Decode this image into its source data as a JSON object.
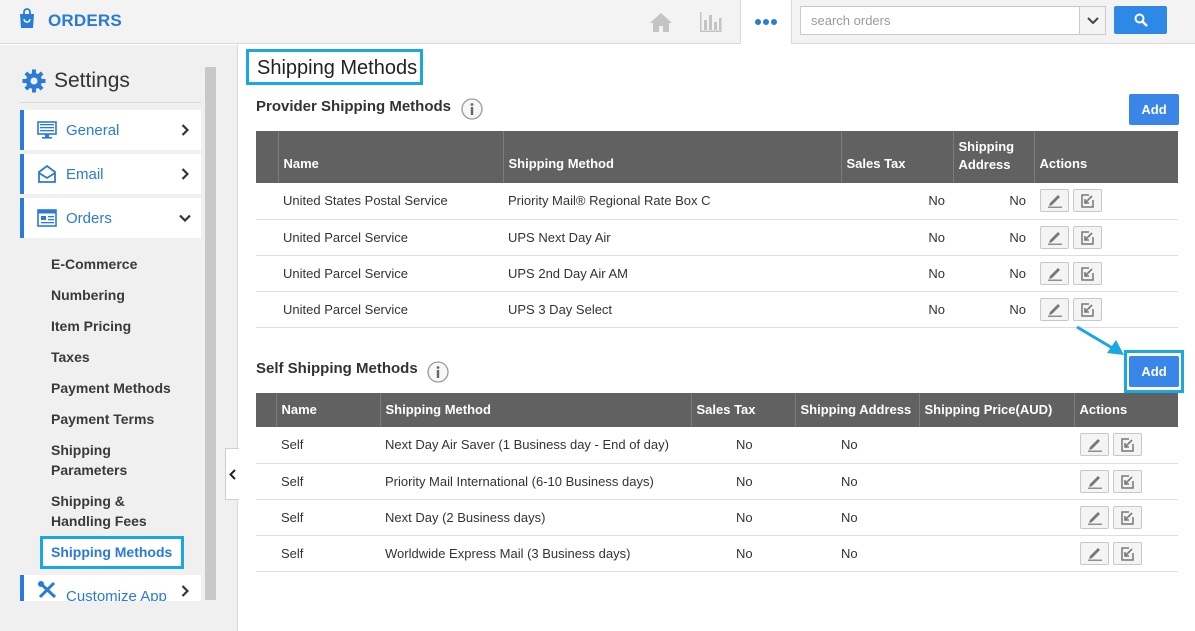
{
  "header": {
    "app_title": "ORDERS",
    "search_placeholder": "search orders"
  },
  "sidebar": {
    "title": "Settings",
    "items": [
      {
        "label": "General"
      },
      {
        "label": "Email"
      },
      {
        "label": "Orders"
      }
    ],
    "sub_items": [
      "E-Commerce",
      "Numbering",
      "Item Pricing",
      "Taxes",
      "Payment Methods",
      "Payment Terms",
      "Shipping Parameters",
      "Shipping & Handling Fees",
      "Shipping Methods"
    ],
    "customize_label": "Customize App"
  },
  "main": {
    "page_title": "Shipping Methods",
    "provider": {
      "title": "Provider Shipping Methods",
      "add_label": "Add",
      "columns": [
        "Name",
        "Shipping Method",
        "Sales Tax",
        "Shipping Address",
        "Actions"
      ],
      "rows": [
        {
          "name": "United States Postal Service",
          "method": "Priority Mail® Regional Rate Box C",
          "sales_tax": "No",
          "shipping_address": "No"
        },
        {
          "name": "United Parcel Service",
          "method": "UPS Next Day Air",
          "sales_tax": "No",
          "shipping_address": "No"
        },
        {
          "name": "United Parcel Service",
          "method": "UPS 2nd Day Air AM",
          "sales_tax": "No",
          "shipping_address": "No"
        },
        {
          "name": "United Parcel Service",
          "method": "UPS 3 Day Select",
          "sales_tax": "No",
          "shipping_address": "No"
        }
      ]
    },
    "self": {
      "title": "Self Shipping Methods",
      "add_label": "Add",
      "columns": [
        "Name",
        "Shipping Method",
        "Sales Tax",
        "Shipping Address",
        "Shipping Price(AUD)",
        "Actions"
      ],
      "rows": [
        {
          "name": "Self",
          "method": "Next Day Air Saver (1 Business day - End of day)",
          "sales_tax": "No",
          "shipping_address": "No",
          "price": ""
        },
        {
          "name": "Self",
          "method": "Priority Mail International (6-10 Business days)",
          "sales_tax": "No",
          "shipping_address": "No",
          "price": ""
        },
        {
          "name": "Self",
          "method": "Next Day (2 Business days)",
          "sales_tax": "No",
          "shipping_address": "No",
          "price": ""
        },
        {
          "name": "Self",
          "method": "Worldwide Express Mail (3 Business days)",
          "sales_tax": "No",
          "shipping_address": "No",
          "price": ""
        }
      ]
    }
  },
  "colors": {
    "accent": "#2a7ad8",
    "highlight": "#19a8e2",
    "table_header": "#616161",
    "add_button": "#3a86e8"
  }
}
